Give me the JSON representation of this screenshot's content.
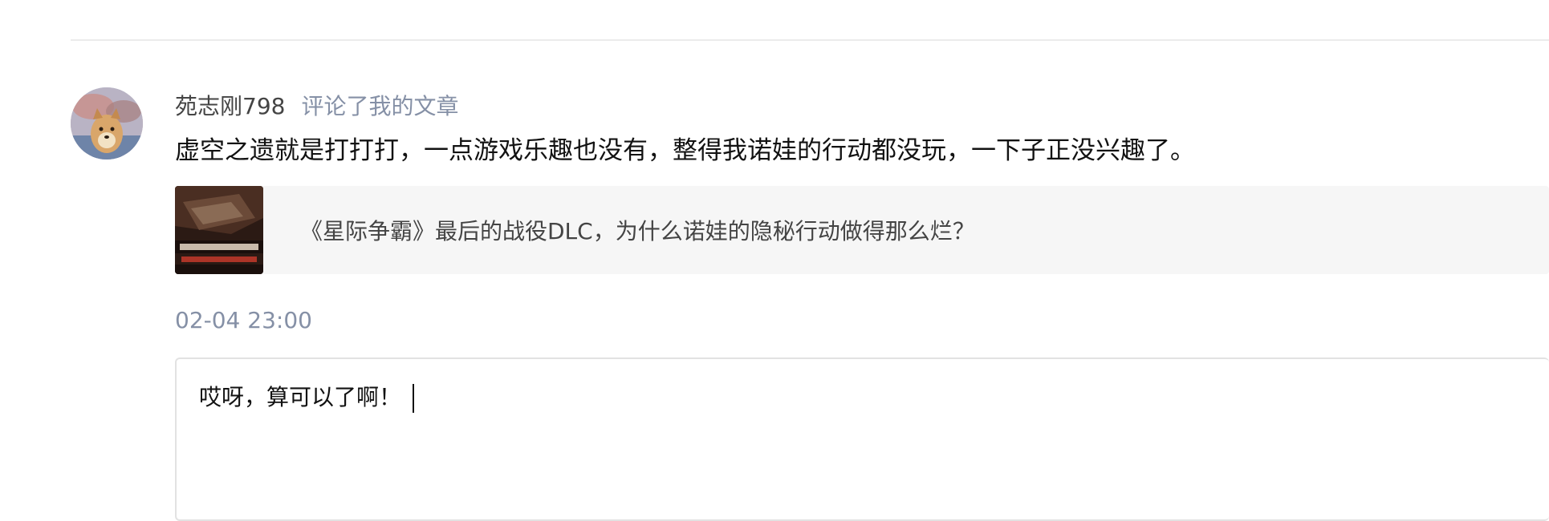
{
  "comment": {
    "username": "苑志刚798",
    "action": "评论了我的文章",
    "body": "虚空之遗就是打打打，一点游戏乐趣也没有，整得我诺娃的行动都没玩，一下子正没兴趣了。",
    "article": {
      "title": "《星际争霸》最后的战役DLC，为什么诺娃的隐秘行动做得那么烂？",
      "thumbnail_icon": "article-thumbnail"
    },
    "timestamp": "02-04 23:00"
  },
  "reply": {
    "text": "哎呀，算可以了啊！"
  },
  "colors": {
    "divider": "#ebebeb",
    "secondary_text": "#8590a6",
    "card_background": "#f6f6f6",
    "input_border": "#e2e2e2"
  }
}
